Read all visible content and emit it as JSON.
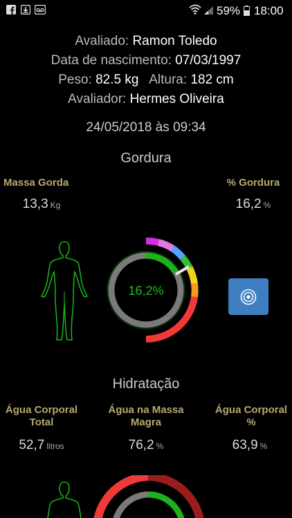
{
  "status_bar": {
    "battery": "59%",
    "time": "18:00",
    "icons": [
      "facebook-icon",
      "download-icon",
      "voicemail-icon",
      "wifi-icon",
      "signal-icon",
      "battery-icon"
    ]
  },
  "info": {
    "avaliado_label": "Avaliado:",
    "avaliado_value": "Ramon Toledo",
    "nascimento_label": "Data de nascimento:",
    "nascimento_value": "07/03/1997",
    "peso_label": "Peso:",
    "peso_value": "82.5 kg",
    "altura_label": "Altura:",
    "altura_value": "182 cm",
    "avaliador_label": "Avaliador:",
    "avaliador_value": "Hermes Oliveira",
    "datetime": "24/05/2018 às 09:34"
  },
  "gordura": {
    "title": "Gordura",
    "massa_label": "Massa Gorda",
    "massa_value": "13,3",
    "massa_unit": "Kg",
    "pct_label": "% Gordura",
    "pct_value": "16,2",
    "pct_unit": "%",
    "gauge_label": "16,2%",
    "gauge_fraction": 0.162,
    "colors": {
      "accent": "#1db11d",
      "track": "#7a7a7a"
    }
  },
  "hidratacao": {
    "title": "Hidratação",
    "agua_total_label": "Água Corporal Total",
    "agua_total_value": "52,7",
    "agua_total_unit": "litros",
    "agua_massa_label": "Água na Massa Magra",
    "agua_massa_value": "76,2",
    "agua_massa_unit": "%",
    "agua_pct_label": "Água Corporal %",
    "agua_pct_value": "63,9",
    "agua_pct_unit": "%"
  }
}
